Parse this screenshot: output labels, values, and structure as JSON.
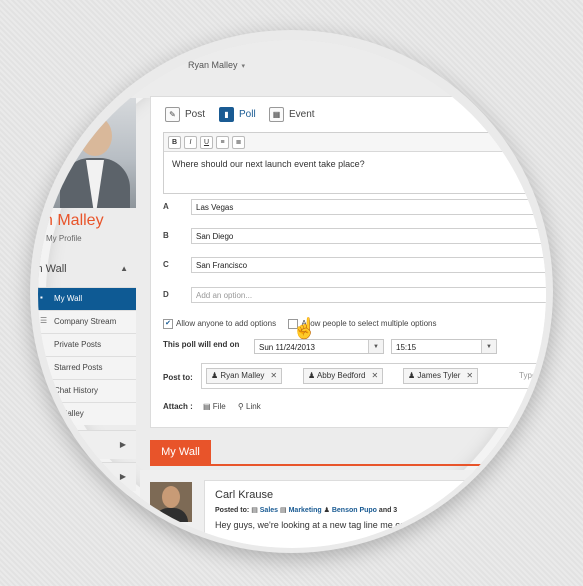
{
  "header": {
    "user_name": "Ryan Malley",
    "caret": "▾"
  },
  "sidebar": {
    "profile_name": "n Malley",
    "profile_link": "My Profile",
    "section_title": "in Wall",
    "items": [
      {
        "label": "My Wall",
        "active": true
      },
      {
        "label": "Company Stream"
      },
      {
        "label": "Private Posts"
      },
      {
        "label": "Starred Posts"
      },
      {
        "label": "Chat History"
      },
      {
        "label": "n Malley"
      }
    ]
  },
  "composer": {
    "tabs": [
      {
        "label": "Post",
        "icon": "✎"
      },
      {
        "label": "Poll",
        "icon": "▮"
      },
      {
        "label": "Event",
        "icon": "▦"
      }
    ],
    "toolbar": [
      "B",
      "I",
      "U",
      "≡",
      "≣"
    ],
    "question": "Where should our next launch event take place?",
    "options": [
      {
        "letter": "A",
        "value": "Las Vegas"
      },
      {
        "letter": "B",
        "value": "San Diego"
      },
      {
        "letter": "C",
        "value": "San Francisco"
      },
      {
        "letter": "D",
        "placeholder": "Add an option..."
      }
    ],
    "allow_add": {
      "label": "Allow anyone to add options",
      "checked": true
    },
    "allow_multiple": {
      "label": "Allow people to select multiple options",
      "checked": false
    },
    "end_label": "This poll will end on",
    "end_date": "Sun 11/24/2013",
    "end_time": "15:15",
    "post_to_label": "Post to:",
    "recipients": [
      "Ryan Malley",
      "Abby Bedford",
      "James Tyler"
    ],
    "recipient_placeholder": "Type the name",
    "attach_label": "Attach :",
    "attach_file": "File",
    "attach_link": "Link"
  },
  "wall": {
    "tab_label": "My Wall",
    "post": {
      "author": "Carl Krause",
      "posted_to_label": "Posted to:",
      "targets": [
        "Sales",
        "Marketing",
        "Benson Pupo"
      ],
      "more": "and 3",
      "body": "Hey guys, we're looking at a new tag line me on this subject)"
    }
  },
  "colors": {
    "accent": "#e8542a",
    "primary": "#1a5b93",
    "active_nav": "#0e5a94"
  }
}
